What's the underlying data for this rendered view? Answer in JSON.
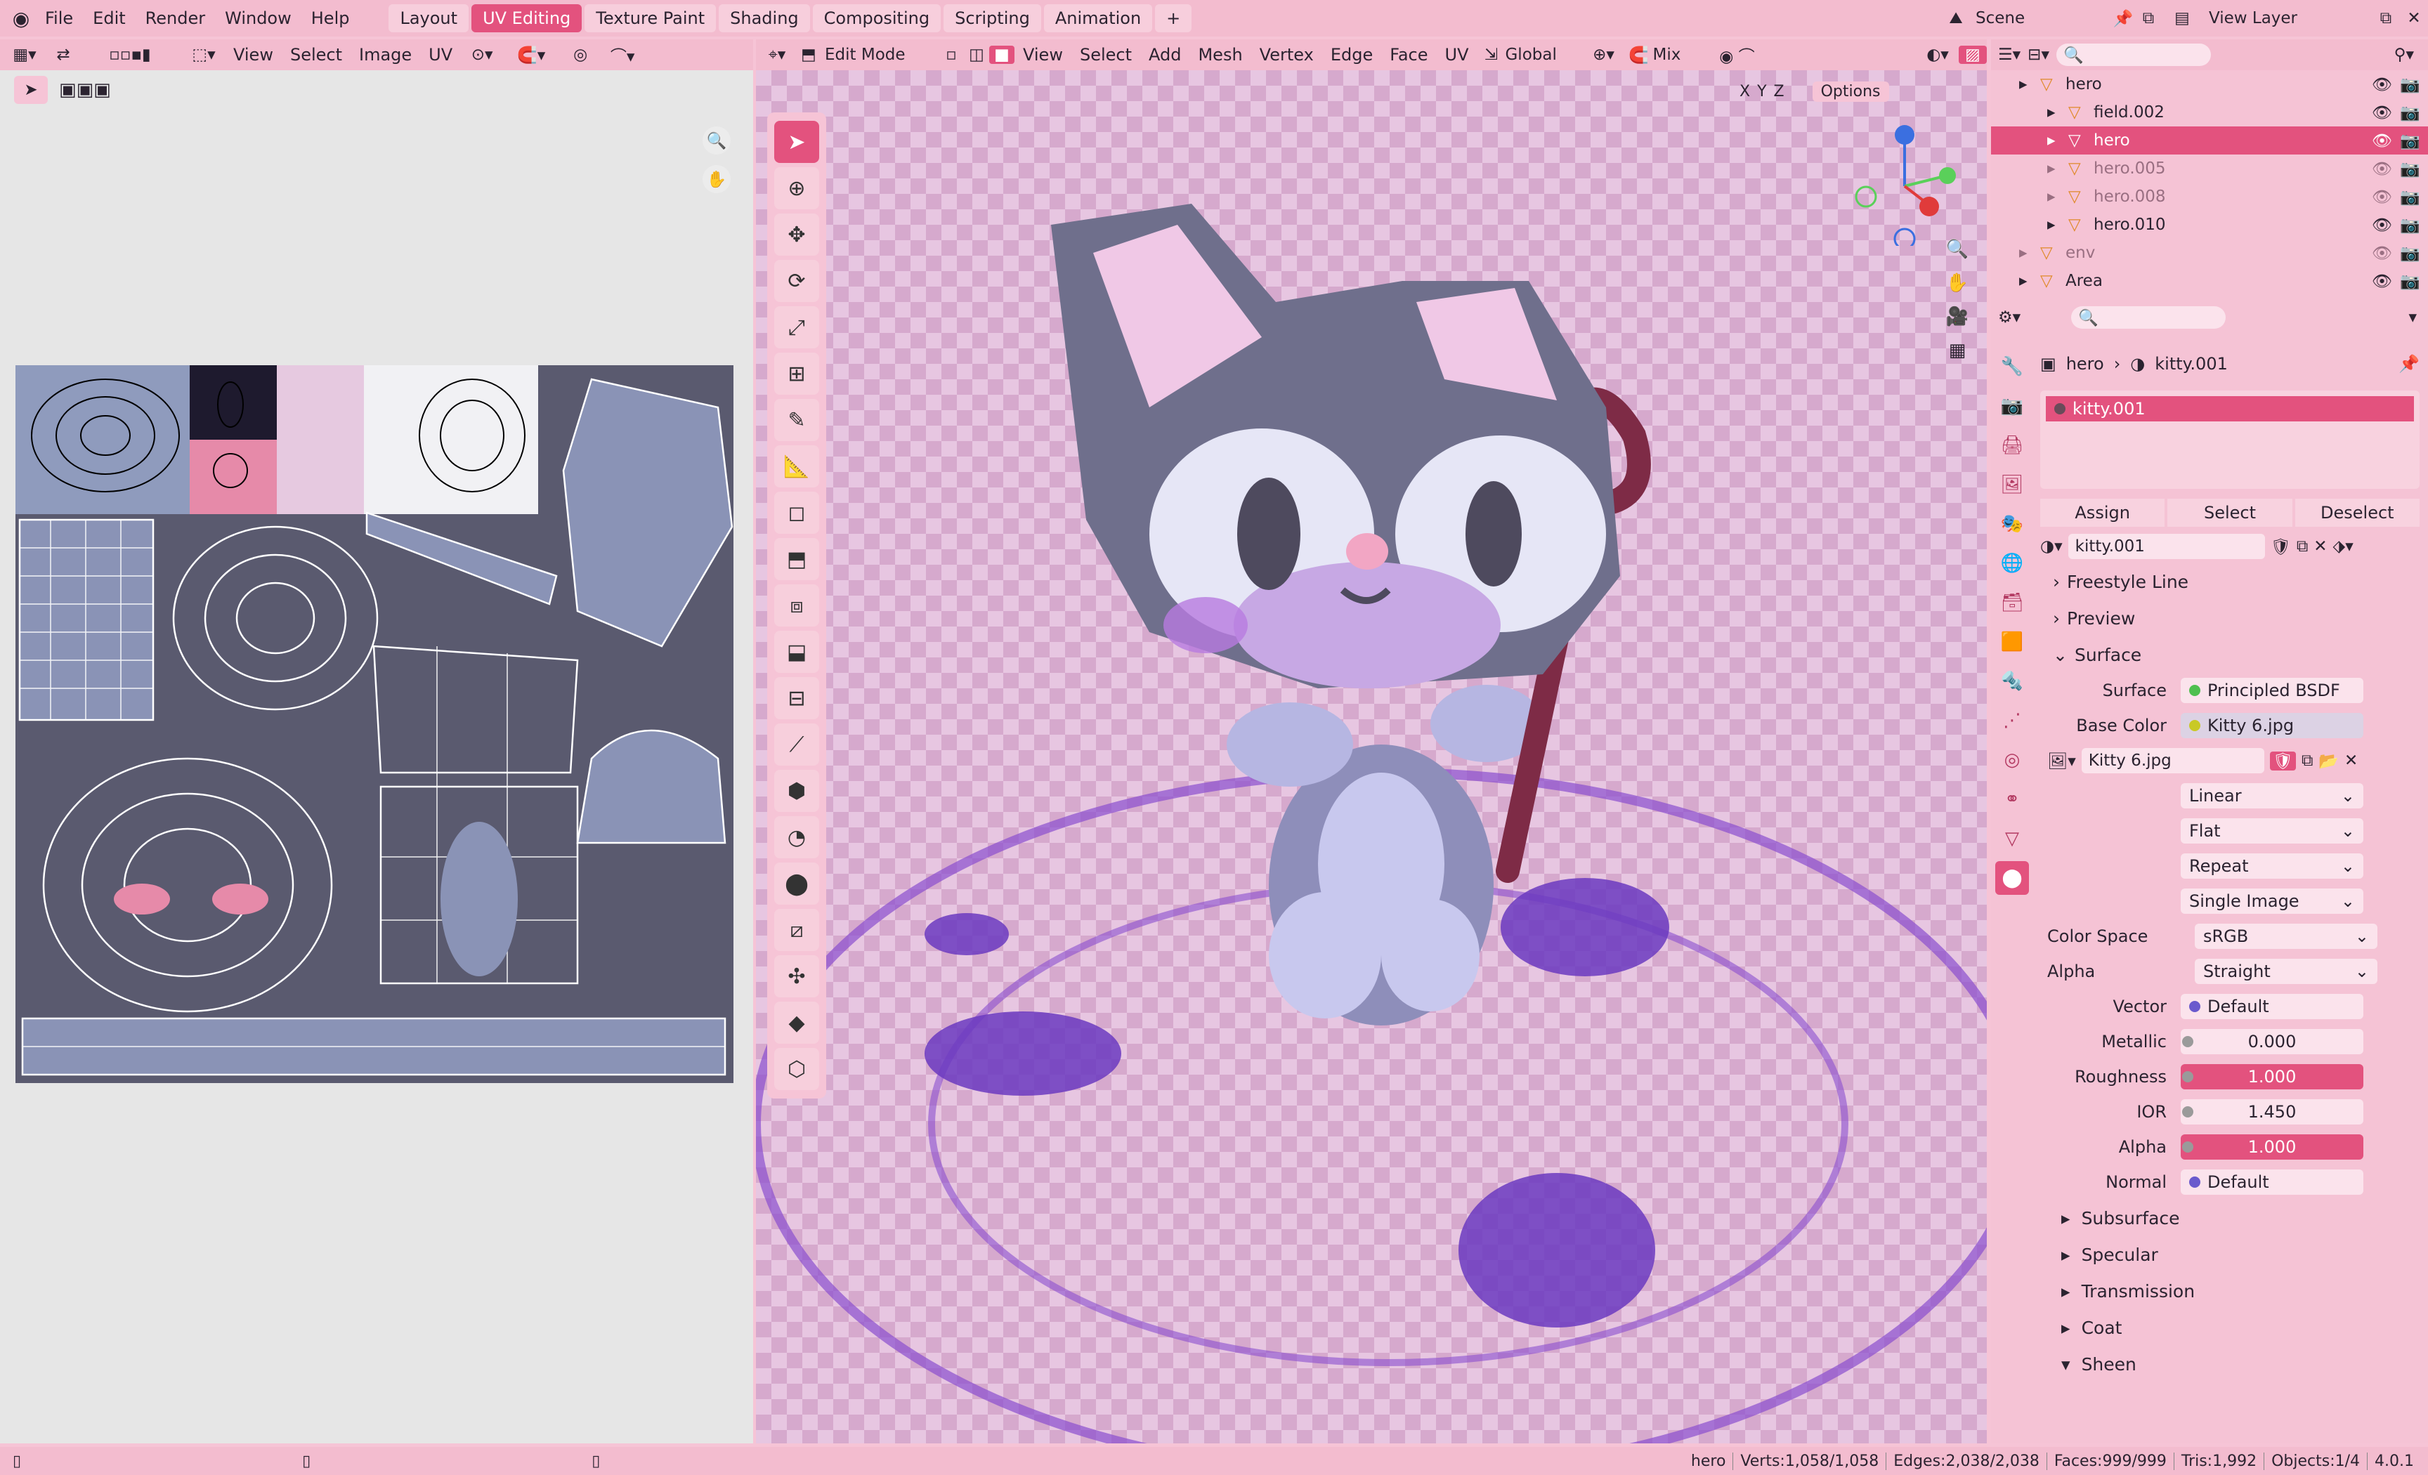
{
  "menu": [
    "File",
    "Edit",
    "Render",
    "Window",
    "Help"
  ],
  "workspaces": [
    "Layout",
    "UV Editing",
    "Texture Paint",
    "Shading",
    "Compositing",
    "Scripting",
    "Animation"
  ],
  "active_workspace": "UV Editing",
  "scene": "Scene",
  "view_layer": "View Layer",
  "uv_header": {
    "items": [
      "View",
      "Select",
      "Image",
      "UV"
    ]
  },
  "vp_header": {
    "mode": "Edit Mode",
    "items": [
      "View",
      "Select",
      "Add",
      "Mesh",
      "Vertex",
      "Edge",
      "Face",
      "UV"
    ],
    "orientation": "Global",
    "blend": "Mix",
    "options": "Options",
    "axes": [
      "X",
      "Y",
      "Z"
    ]
  },
  "outliner": {
    "rows": [
      {
        "name": "hero",
        "indent": 1
      },
      {
        "name": "field.002",
        "indent": 2
      },
      {
        "name": "hero",
        "indent": 2,
        "selected": true
      },
      {
        "name": "hero.005",
        "indent": 2,
        "dim": true
      },
      {
        "name": "hero.008",
        "indent": 2,
        "dim": true
      },
      {
        "name": "hero.010",
        "indent": 2
      },
      {
        "name": "env",
        "indent": 1,
        "dim": true
      },
      {
        "name": "Area",
        "indent": 1
      }
    ]
  },
  "props": {
    "breadcrumb": [
      "hero",
      "kitty.001"
    ],
    "material_slot": "kitty.001",
    "assign": "Assign",
    "select": "Select",
    "deselect": "Deselect",
    "material_name": "kitty.001",
    "sections": {
      "freestyle": "Freestyle Line",
      "preview": "Preview",
      "surface": "Surface"
    },
    "surface_label": "Surface",
    "surface_value": "Principled BSDF",
    "base_color_label": "Base Color",
    "base_color_value": "Kitty 6.jpg",
    "image_name": "Kitty 6.jpg",
    "dropdowns": [
      "Linear",
      "Flat",
      "Repeat",
      "Single Image"
    ],
    "color_space_label": "Color Space",
    "color_space_value": "sRGB",
    "alpha_mode_label": "Alpha",
    "alpha_mode_value": "Straight",
    "params": [
      {
        "label": "Vector",
        "value": "Default",
        "type": "link"
      },
      {
        "label": "Metallic",
        "value": "0.000",
        "type": "num"
      },
      {
        "label": "Roughness",
        "value": "1.000",
        "type": "pink"
      },
      {
        "label": "IOR",
        "value": "1.450",
        "type": "num"
      },
      {
        "label": "Alpha",
        "value": "1.000",
        "type": "pink"
      },
      {
        "label": "Normal",
        "value": "Default",
        "type": "link"
      }
    ],
    "subsections": [
      "Subsurface",
      "Specular",
      "Transmission",
      "Coat",
      "Sheen"
    ]
  },
  "status": {
    "object": "hero",
    "verts": "Verts:1,058/1,058",
    "edges": "Edges:2,038/2,038",
    "faces": "Faces:999/999",
    "tris": "Tris:1,992",
    "objects": "Objects:1/4",
    "version": "4.0.1"
  },
  "colors": {
    "accent": "#e3527e",
    "bg": "#f6c4d6"
  }
}
